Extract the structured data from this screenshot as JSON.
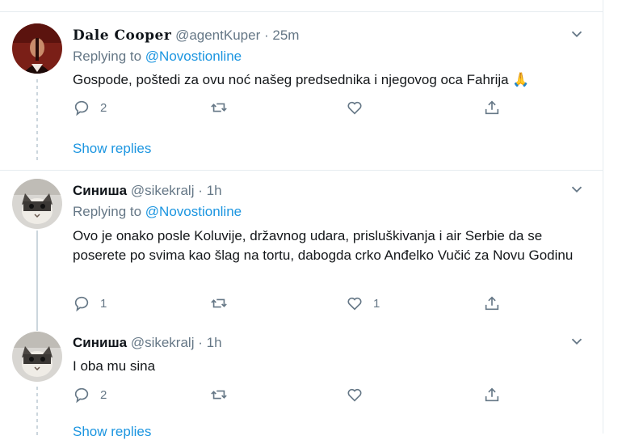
{
  "tweets": [
    {
      "name": "Dale Cooper",
      "handle": "@agentKuper",
      "dot": "·",
      "time": "25m",
      "replying_prefix": "Replying to",
      "replying_to": "@Novostionline",
      "text": "Gospode, poštedi za ovu noć našeg predsednika i njegovog oca Fahrija",
      "emoji": "🙏",
      "reply_count": "2",
      "retweet_count": "",
      "like_count": "",
      "show_replies": "Show replies"
    },
    {
      "name": "Синиша",
      "handle": "@sikekralj",
      "dot": "·",
      "time": "1h",
      "replying_prefix": "Replying to",
      "replying_to": "@Novostionline",
      "text": "Ovo je onako posle Koluvije, državnog udara, prisluškivanja i air Serbie da se poserete po svima kao šlag na tortu, dabogda crko Anđelko Vučić za Novu Godinu",
      "reply_count": "1",
      "retweet_count": "",
      "like_count": "1"
    },
    {
      "name": "Синиша",
      "handle": "@sikekralj",
      "dot": "·",
      "time": "1h",
      "text": "I oba mu sina",
      "reply_count": "2",
      "retweet_count": "",
      "like_count": "",
      "show_replies": "Show replies"
    }
  ],
  "icons": {
    "reply": "reply-icon",
    "retweet": "retweet-icon",
    "like": "heart-icon",
    "share": "share-icon",
    "caret": "chevron-down-icon"
  },
  "colors": {
    "link": "#1b95e0",
    "muted": "#657786",
    "border": "#e6ecf0"
  }
}
